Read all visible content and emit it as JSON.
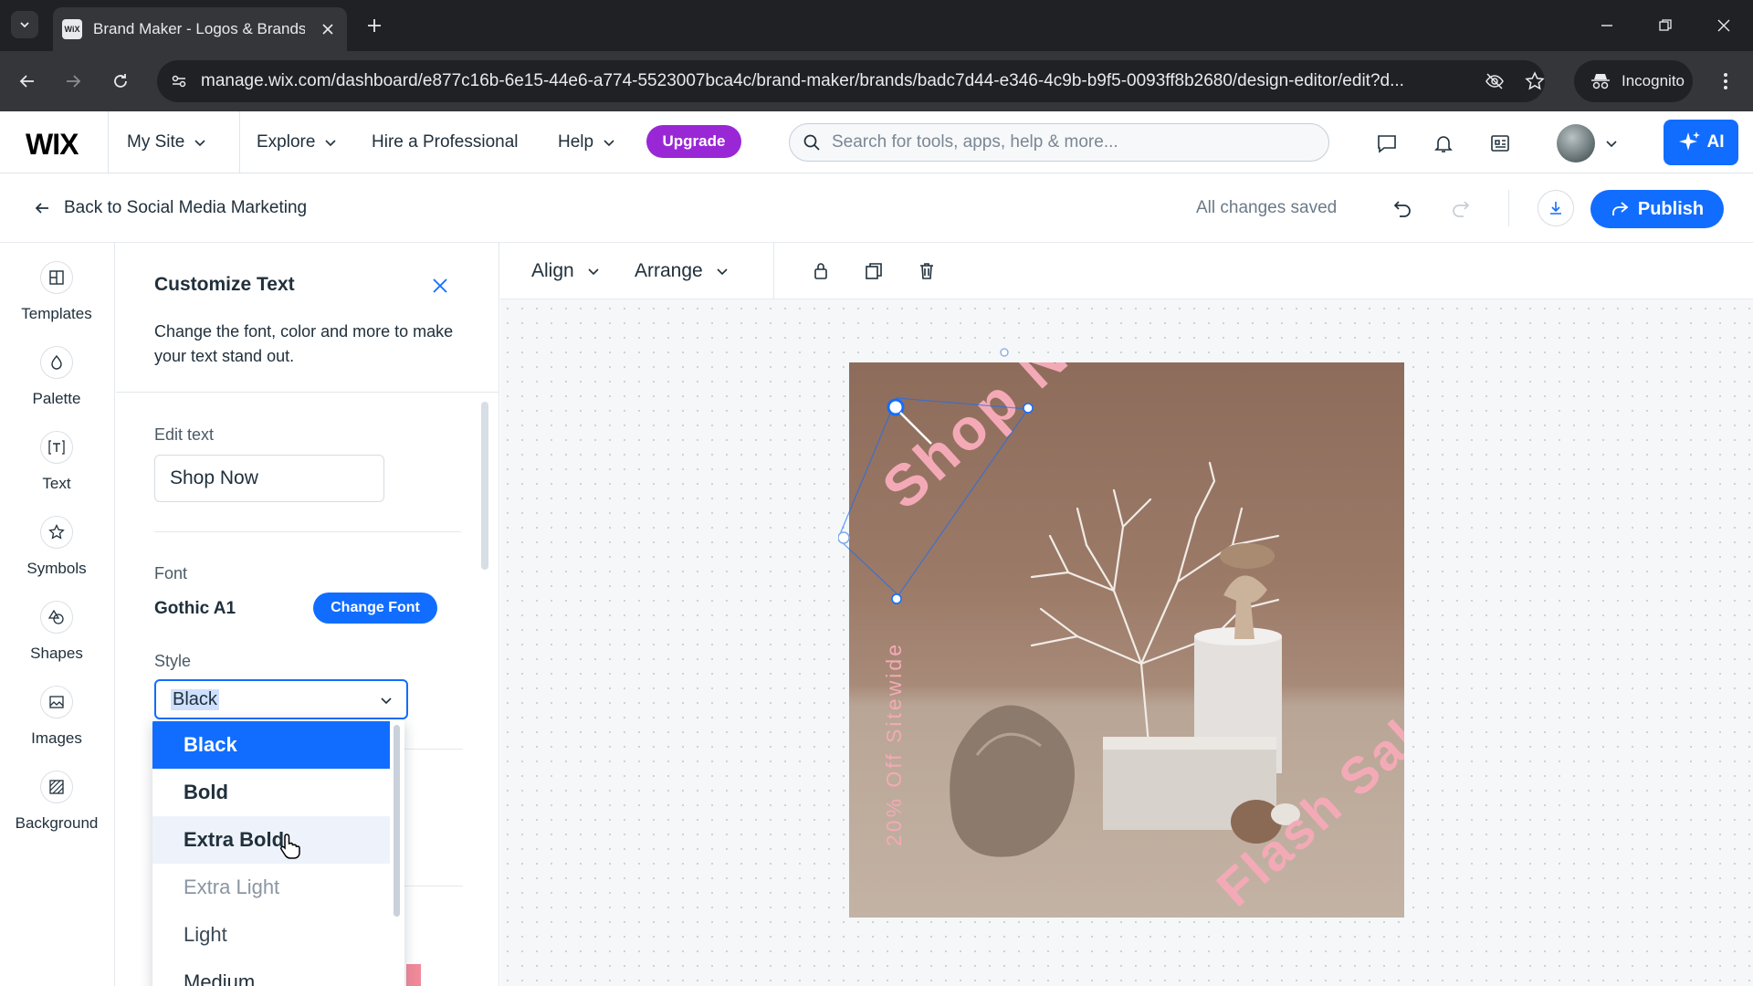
{
  "browser": {
    "tab_title": "Brand Maker - Logos & Brands",
    "favicon_text": "WiX",
    "url": "manage.wix.com/dashboard/e877c16b-6e15-44e6-a774-5523007bca4c/brand-maker/brands/badc7d44-e346-4c9b-b9f5-0093ff8b2680/design-editor/edit?d...",
    "incognito_label": "Incognito"
  },
  "wix_header": {
    "logo": "WIX",
    "my_site": "My Site",
    "explore": "Explore",
    "hire": "Hire a Professional",
    "help": "Help",
    "upgrade": "Upgrade",
    "search_placeholder": "Search for tools, apps, help & more...",
    "ai_label": "AI"
  },
  "editor_header": {
    "back_label": "Back to Social Media Marketing",
    "status": "All changes saved",
    "publish": "Publish"
  },
  "rail": {
    "items": [
      {
        "label": "Templates",
        "icon": "templates-icon"
      },
      {
        "label": "Palette",
        "icon": "palette-icon"
      },
      {
        "label": "Text",
        "icon": "text-icon"
      },
      {
        "label": "Symbols",
        "icon": "star-icon"
      },
      {
        "label": "Shapes",
        "icon": "shapes-icon"
      },
      {
        "label": "Images",
        "icon": "image-icon"
      },
      {
        "label": "Background",
        "icon": "background-icon"
      }
    ]
  },
  "panel": {
    "title": "Customize Text",
    "description": "Change the font, color and more to make your text stand out.",
    "edit_text_label": "Edit text",
    "edit_text_value": "Shop Now",
    "font_label": "Font",
    "font_value": "Gothic A1",
    "change_font": "Change Font",
    "style_label": "Style",
    "style_value": "Black",
    "style_options": [
      "Black",
      "Bold",
      "Extra Bold",
      "Extra Light",
      "Light",
      "Medium"
    ]
  },
  "canvas_toolbar": {
    "align": "Align",
    "arrange": "Arrange"
  },
  "design": {
    "headline": "Shop Now",
    "subline": "20% Off Sitewide",
    "tagline": "Flash Sale",
    "text_color": "#f3aab6"
  },
  "colors": {
    "accent": "#116dff",
    "upgrade": "#9a27d5"
  }
}
